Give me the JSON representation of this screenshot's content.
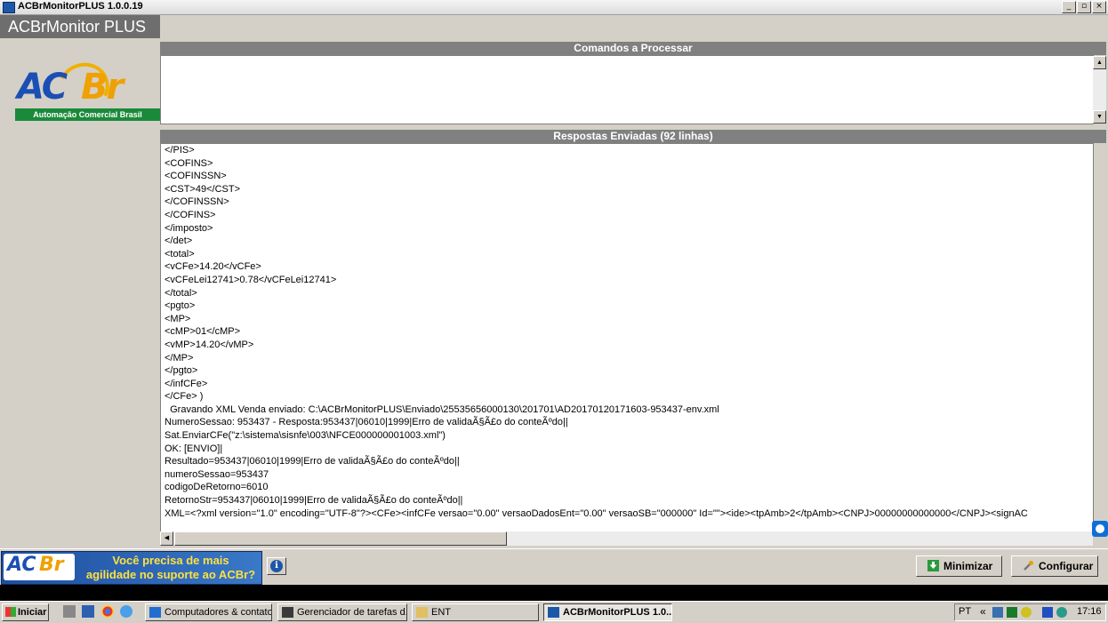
{
  "window": {
    "title": "ACBrMonitorPLUS 1.0.0.19",
    "controls": {
      "minimize": "_",
      "restore": "▫",
      "close": "×"
    }
  },
  "sidebar": {
    "app_name": "ACBrMonitor PLUS",
    "logo": {
      "ac": "AC",
      "br": "Br",
      "tagline": "Automação Comercial Brasil"
    }
  },
  "commands_panel": {
    "title": "Comandos a Processar"
  },
  "responses_panel": {
    "title": "Respostas Enviadas (92 linhas)",
    "lines": [
      "</PIS>",
      "<COFINS>",
      "<COFINSSN>",
      "<CST>49</CST>",
      "</COFINSSN>",
      "</COFINS>",
      "</imposto>",
      "</det>",
      "<total>",
      "<vCFe>14.20</vCFe>",
      "<vCFeLei12741>0.78</vCFeLei12741>",
      "</total>",
      "<pgto>",
      "<MP>",
      "<cMP>01</cMP>",
      "<vMP>14.20</vMP>",
      "</MP>",
      "</pgto>",
      "</infCFe>",
      "</CFe> )",
      "  Gravando XML Venda enviado: C:\\ACBrMonitorPLUS\\Enviado\\25535656000130\\201701\\AD20170120171603-953437-env.xml",
      "NumeroSessao: 953437 - Resposta:953437|06010|1999|Erro de validaÃ§Ã£o do conteÃºdo||",
      "Sat.EnviarCFe(\"z:\\sistema\\sisnfe\\003\\NFCE000000001003.xml\")",
      "OK: [ENVIO]|",
      "Resultado=953437|06010|1999|Erro de validaÃ§Ã£o do conteÃºdo||",
      "numeroSessao=953437",
      "codigoDeRetorno=6010",
      "RetornoStr=953437|06010|1999|Erro de validaÃ§Ã£o do conteÃºdo||",
      "XML=<?xml version=\"1.0\" encoding=\"UTF-8\"?><CFe><infCFe versao=\"0.00\" versaoDadosEnt=\"0.00\" versaoSB=\"000000\" Id=\"\"><ide><tpAmb>2</tpAmb><CNPJ>00000000000000</CNPJ><signAC"
    ]
  },
  "bottom_panel": {
    "banner_logo": {
      "ac": "AC",
      "br": "Br"
    },
    "banner_line1": "Você precisa de mais",
    "banner_line2": "agilidade no suporte ao ACBr?",
    "info_label": "i",
    "minimize_label": "Minimizar",
    "configure_label": "Configurar"
  },
  "taskbar": {
    "start_label": "Iniciar",
    "tasks": [
      "Computadores & contatos",
      "Gerenciador de tarefas d...",
      "ENT",
      "ACBrMonitorPLUS 1.0..."
    ],
    "language": "PT",
    "tray_arrows": "«",
    "clock": "17:16"
  }
}
